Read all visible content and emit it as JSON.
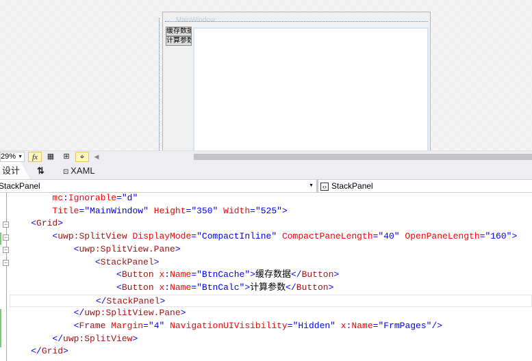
{
  "designer": {
    "window_title": "MainWindow",
    "pane_buttons": [
      "缓存数据",
      "计算参数"
    ]
  },
  "toolbar": {
    "zoom": "29%",
    "icons": [
      "fx-icon",
      "grid-icon",
      "snap-grid-icon",
      "snap-lines-icon"
    ]
  },
  "tabs": {
    "design": "设计",
    "swap": "⇅",
    "xaml": "XAML"
  },
  "navbar": {
    "left": "StackPanel",
    "right": "StackPanel"
  },
  "code": {
    "lines": [
      [
        [
          "        ",
          "k"
        ],
        [
          "mc",
          "r"
        ],
        [
          ":",
          "b"
        ],
        [
          "Ignorable",
          "r"
        ],
        [
          "=",
          "b"
        ],
        [
          "\"d\"",
          "b"
        ]
      ],
      [
        [
          "        ",
          "k"
        ],
        [
          "Title",
          "r"
        ],
        [
          "=",
          "b"
        ],
        [
          "\"MainWindow\"",
          "b"
        ],
        [
          " ",
          "k"
        ],
        [
          "Height",
          "r"
        ],
        [
          "=",
          "b"
        ],
        [
          "\"350\"",
          "b"
        ],
        [
          " ",
          "k"
        ],
        [
          "Width",
          "r"
        ],
        [
          "=",
          "b"
        ],
        [
          "\"525\"",
          "b"
        ],
        [
          ">",
          "b"
        ]
      ],
      [
        [
          "    ",
          "k"
        ],
        [
          "<",
          "b"
        ],
        [
          "Grid",
          "m"
        ],
        [
          ">",
          "b"
        ]
      ],
      [
        [
          "        ",
          "k"
        ],
        [
          "<",
          "b"
        ],
        [
          "uwp:SplitView",
          "m"
        ],
        [
          " ",
          "k"
        ],
        [
          "DisplayMode",
          "r"
        ],
        [
          "=",
          "b"
        ],
        [
          "\"CompactInline\"",
          "b"
        ],
        [
          " ",
          "k"
        ],
        [
          "CompactPaneLength",
          "r"
        ],
        [
          "=",
          "b"
        ],
        [
          "\"40\"",
          "b"
        ],
        [
          " ",
          "k"
        ],
        [
          "OpenPaneLength",
          "r"
        ],
        [
          "=",
          "b"
        ],
        [
          "\"160\"",
          "b"
        ],
        [
          ">",
          "b"
        ]
      ],
      [
        [
          "            ",
          "k"
        ],
        [
          "<",
          "b"
        ],
        [
          "uwp:SplitView.Pane",
          "m"
        ],
        [
          ">",
          "b"
        ]
      ],
      [
        [
          "                ",
          "k"
        ],
        [
          "<",
          "b"
        ],
        [
          "StackPanel",
          "m"
        ],
        [
          ">",
          "b"
        ]
      ],
      [
        [
          "                    ",
          "k"
        ],
        [
          "<",
          "b"
        ],
        [
          "Button",
          "m"
        ],
        [
          " ",
          "k"
        ],
        [
          "x",
          "r"
        ],
        [
          ":",
          "b"
        ],
        [
          "Name",
          "r"
        ],
        [
          "=",
          "b"
        ],
        [
          "\"BtnCache\"",
          "b"
        ],
        [
          ">",
          "b"
        ],
        [
          "缓存数据",
          "k"
        ],
        [
          "</",
          "b"
        ],
        [
          "Button",
          "m"
        ],
        [
          ">",
          "b"
        ]
      ],
      [
        [
          "                    ",
          "k"
        ],
        [
          "<",
          "b"
        ],
        [
          "Button",
          "m"
        ],
        [
          " ",
          "k"
        ],
        [
          "x",
          "r"
        ],
        [
          ":",
          "b"
        ],
        [
          "Name",
          "r"
        ],
        [
          "=",
          "b"
        ],
        [
          "\"BtnCalc\"",
          "b"
        ],
        [
          ">",
          "b"
        ],
        [
          "计算参数",
          "k"
        ],
        [
          "</",
          "b"
        ],
        [
          "Button",
          "m"
        ],
        [
          ">",
          "b"
        ]
      ],
      [
        [
          "                ",
          "k"
        ],
        [
          "</",
          "b"
        ],
        [
          "StackPanel",
          "m"
        ],
        [
          ">",
          "b"
        ]
      ],
      [
        [
          "            ",
          "k"
        ],
        [
          "</",
          "b"
        ],
        [
          "uwp:SplitView.Pane",
          "m"
        ],
        [
          ">",
          "b"
        ]
      ],
      [
        [
          "            ",
          "k"
        ],
        [
          "<",
          "b"
        ],
        [
          "Frame",
          "m"
        ],
        [
          " ",
          "k"
        ],
        [
          "Margin",
          "r"
        ],
        [
          "=",
          "b"
        ],
        [
          "\"4\"",
          "b"
        ],
        [
          " ",
          "k"
        ],
        [
          "NavigationUIVisibility",
          "r"
        ],
        [
          "=",
          "b"
        ],
        [
          "\"Hidden\"",
          "b"
        ],
        [
          " ",
          "k"
        ],
        [
          "x",
          "r"
        ],
        [
          ":",
          "b"
        ],
        [
          "Name",
          "r"
        ],
        [
          "=",
          "b"
        ],
        [
          "\"FrmPages\"",
          "b"
        ],
        [
          "/>",
          "b"
        ]
      ],
      [
        [
          "        ",
          "k"
        ],
        [
          "</",
          "b"
        ],
        [
          "uwp:SplitView",
          "m"
        ],
        [
          ">",
          "b"
        ]
      ],
      [
        [
          "    ",
          "k"
        ],
        [
          "</",
          "b"
        ],
        [
          "Grid",
          "m"
        ],
        [
          ">",
          "b"
        ]
      ]
    ]
  }
}
